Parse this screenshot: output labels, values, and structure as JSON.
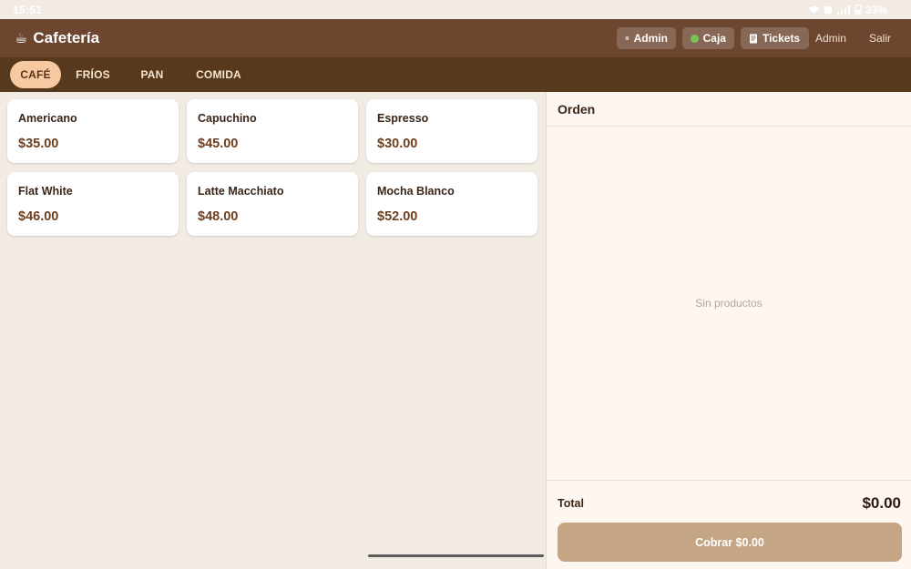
{
  "status_bar": {
    "time": "15:51",
    "battery": "33%"
  },
  "app": {
    "cup": "☕",
    "title": "Cafetería"
  },
  "header": {
    "admin_pill": "Admin",
    "caja_pill": "Caja",
    "tickets_pill": "Tickets",
    "admin_link": "Admin",
    "salir_link": "Salir"
  },
  "tabs": [
    {
      "label": "CAFÉ",
      "active": true
    },
    {
      "label": "FRÍOS",
      "active": false
    },
    {
      "label": "PAN",
      "active": false
    },
    {
      "label": "COMIDA",
      "active": false
    }
  ],
  "products": [
    {
      "name": "Americano",
      "price": "$35.00"
    },
    {
      "name": "Capuchino",
      "price": "$45.00"
    },
    {
      "name": "Espresso",
      "price": "$30.00"
    },
    {
      "name": "Flat White",
      "price": "$46.00"
    },
    {
      "name": "Latte Macchiato",
      "price": "$48.00"
    },
    {
      "name": "Mocha Blanco",
      "price": "$52.00"
    }
  ],
  "order": {
    "title": "Orden",
    "empty_text": "Sin productos",
    "total_label": "Total",
    "total_value": "$0.00",
    "charge_label": "Cobrar $0.00"
  },
  "colors": {
    "header": "#6d4630",
    "tabbar": "#573a1e",
    "active_tab": "#f7c9a1",
    "charge_button": "#c4a584",
    "caja_status": "#7cc25a"
  }
}
